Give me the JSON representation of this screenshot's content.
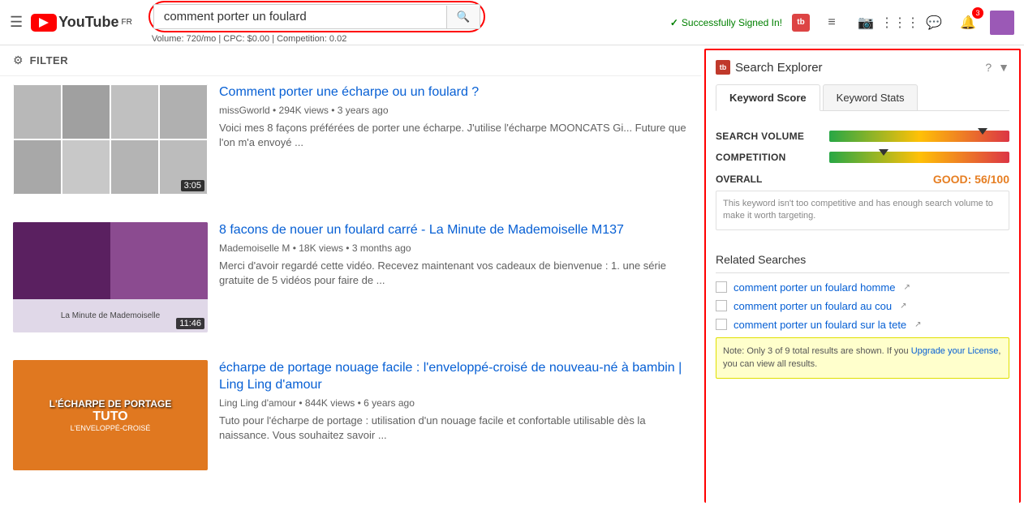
{
  "topbar": {
    "logo_text": "YouTube",
    "logo_sup": "FR",
    "search_value": "comment porter un foulard",
    "search_placeholder": "Search",
    "search_meta": "Volume: 720/mo | CPC: $0.00 | Competition: 0.02",
    "signed_in_text": "Successfully Signed In!",
    "notif_count": "3"
  },
  "filter": {
    "label": "FILTER"
  },
  "videos": [
    {
      "title": "Comment porter une écharpe ou un foulard ?",
      "channel": "missGworld",
      "views": "294K views",
      "age": "3 years ago",
      "desc": "Voici mes 8 façons préférées de porter une écharpe. J'utilise l'écharpe MOONCATS Gi... Future que l'on m'a envoyé ...",
      "duration": "3:05",
      "thumb_type": "grid"
    },
    {
      "title": "8 facons de nouer un foulard carré - La Minute de Mademoiselle M137",
      "channel": "Mademoiselle M",
      "views": "18K views",
      "age": "3 months ago",
      "desc": "Merci d'avoir regardé cette vidéo. Recevez maintenant vos cadeaux de bienvenue : 1. une série gratuite de 5 vidéos pour faire de ...",
      "duration": "11:46",
      "thumb_type": "purple"
    },
    {
      "title": "écharpe de portage nouage facile : l'enveloppé-croisé de nouveau-né à bambin | Ling Ling d'amour",
      "channel": "Ling Ling d'amour",
      "views": "844K views",
      "age": "6 years ago",
      "desc": "Tuto pour l'écharpe de portage : utilisation d'un nouage facile et confortable utilisable dès la naissance. Vous souhaitez savoir ...",
      "duration": "",
      "thumb_type": "orange"
    }
  ],
  "panel": {
    "title": "Search Explorer",
    "tab_keyword_score": "Keyword Score",
    "tab_keyword_stats": "Keyword Stats",
    "search_volume_label": "SEARCH VOLUME",
    "competition_label": "COMPETITION",
    "overall_label": "OVERALL",
    "overall_value": "GOOD: 56/100",
    "overall_desc": "This keyword isn't too competitive and has enough search volume to make it worth targeting.",
    "search_volume_marker": "85",
    "competition_marker": "30",
    "related_header": "Related Searches",
    "related_items": [
      {
        "text": "comment porter un foulard homme",
        "link": true
      },
      {
        "text": "comment porter un foulard au cou",
        "link": true
      },
      {
        "text": "comment porter un foulard sur la tete",
        "link": true
      }
    ],
    "note_text": "Note: Only 3 of 9 total results are shown. If you ",
    "note_link": "Upgrade your License",
    "note_text2": ", you can view all results."
  }
}
